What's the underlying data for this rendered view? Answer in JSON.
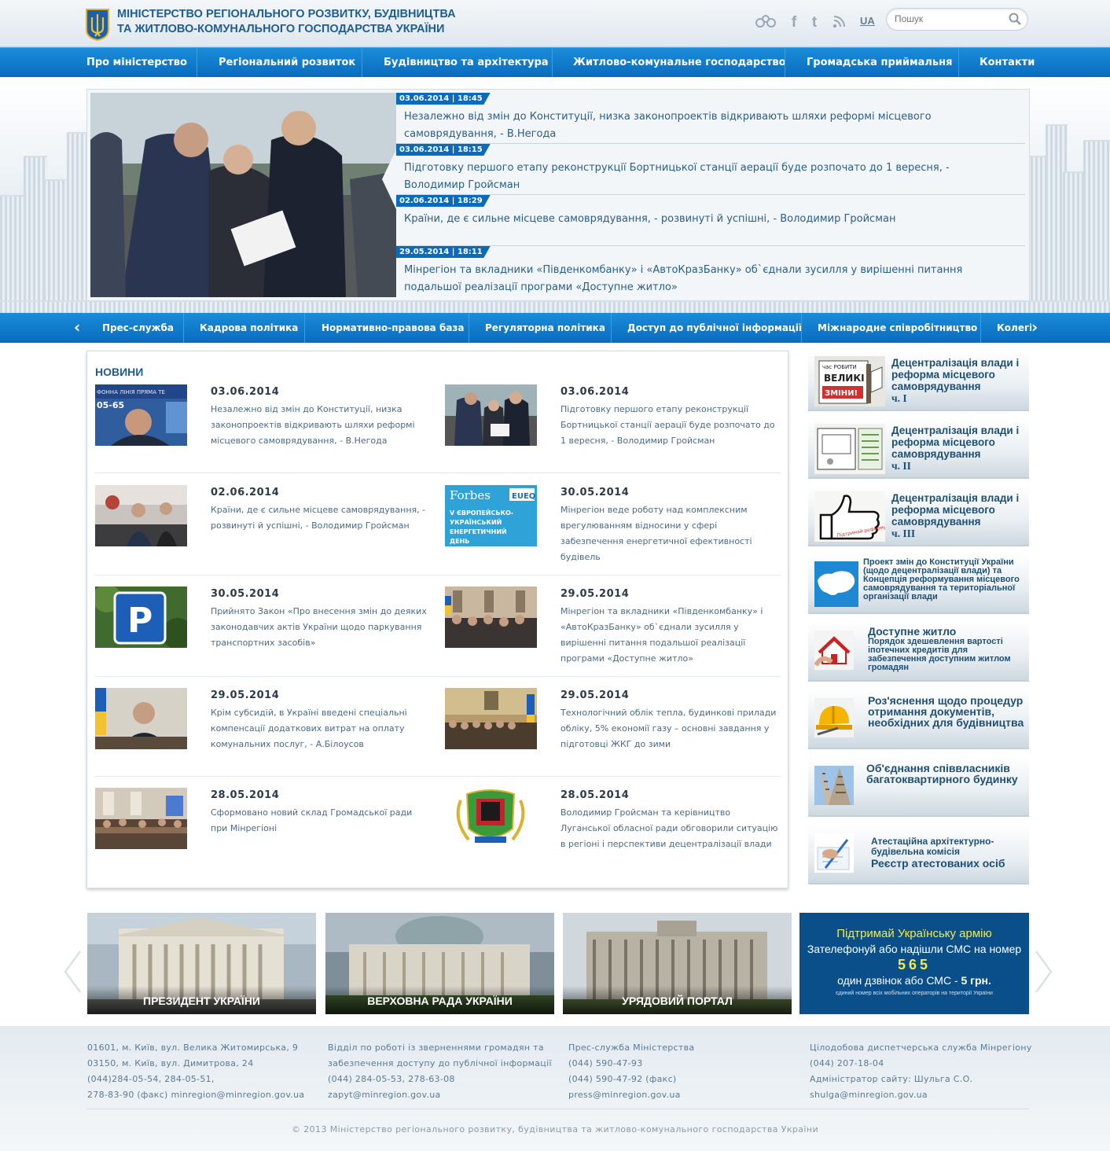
{
  "header": {
    "title_line1": "Міністерство регіонального розвитку, будівництва",
    "title_line2": "та житлово-комунального господарства України",
    "lang": "UA",
    "search_placeholder": "Пошук",
    "icons": [
      "flickr-icon",
      "facebook-icon",
      "twitter-icon",
      "rss-icon"
    ]
  },
  "nav": [
    "Про міністерство",
    "Регіональний розвиток",
    "Будівництво та архітектура",
    "Житлово-комунальне господарство",
    "Громадська приймальня",
    "Контакти"
  ],
  "hero": {
    "items": [
      {
        "date": "03.06.2014 | 18:45",
        "title": "Незалежно від змін до Конституції, низка законопроектів відкривають шляхи реформі місцевого самоврядування, - В.Негода"
      },
      {
        "date": "03.06.2014 | 18:15",
        "title": "Підготовку першого етапу реконструкції Бортницької станції аерації буде розпочато до 1 вересня, - Володимир Гройсман"
      },
      {
        "date": "02.06.2014 | 18:29",
        "title": "Країни, де є сильне місцеве самоврядування, - розвинуті й успішні, - Володимир Гройсман"
      },
      {
        "date": "29.05.2014 | 18:11",
        "title": "Мінрегіон та вкладники «Південкомбанку» і «АвтоКразБанку» об`єднали зусилля у вирішенні питання подальшої реалізації програми «Доступне житло»"
      }
    ]
  },
  "subnav": [
    "Прес-служба",
    "Кадрова політика",
    "Нормативно-правова база",
    "Регуляторна політика",
    "Доступ до публічної інформації",
    "Міжнародне співробітництво",
    "Колегія"
  ],
  "news": {
    "heading": "НОВИНИ",
    "items": [
      {
        "date": "03.06.2014",
        "text": "Незалежно від змін до Конституції, низка законопроектів відкривають шляхи реформі місцевого самоврядування, - В.Негода"
      },
      {
        "date": "03.06.2014",
        "text": "Підготовку першого етапу реконструкції Бортницької станції аерації буде розпочато до 1 вересня, - Володимир Гройсман"
      },
      {
        "date": "02.06.2014",
        "text": "Країни, де є сильне місцеве самоврядування, - розвинуті й успішні, - Володимир Гройсман"
      },
      {
        "date": "30.05.2014",
        "text": "Мінрегіон веде роботу над комплексним врегулюванням відносини у сфері забезпечення енергетичної ефективності будівель"
      },
      {
        "date": "30.05.2014",
        "text": "Прийнято Закон «Про внесення змін до деяких законодавчих актів України щодо паркування транспортних засобів»"
      },
      {
        "date": "29.05.2014",
        "text": "Мінрегіон та вкладники «Південкомбанку» і «АвтоКразБанку» об`єднали зусилля у вирішенні питання подальшої реалізації програми «Доступне житло»"
      },
      {
        "date": "29.05.2014",
        "text": "Крім субсидій, в Україні введені спеціальні компенсації додаткових витрат на оплату комунальних послуг, - А.Білоусов"
      },
      {
        "date": "29.05.2014",
        "text": "Технологічний облік тепла, будинкові прилади обліку, 5% економії газу – основні завдання у підготовці ЖКГ до зими"
      },
      {
        "date": "28.05.2014",
        "text": "Сформовано новий склад Громадської ради при Мінрегіоні"
      },
      {
        "date": "28.05.2014",
        "text": "Володимир Гройсман та керівництво Луганської обласної ради обговорили ситуацію в регіоні і перспективи децентралізації влади"
      }
    ],
    "thumb_texts": {
      "forbes": "Forbes",
      "eueq": "EUEQ",
      "energy_day": "V ЄВРОПЕЙСЬКО-УКРАЇНСЬКИЙ ЕНЕРГЕТИЧНИЙ ДЕНЬ",
      "phone_banner": "ФОННА ЛІНІЯ ПРЯМА ТЕ",
      "phone_number": "05-65",
      "parking": "P"
    }
  },
  "sidebar": [
    {
      "title": "Децентралізація влади і реформа місцевого самоврядування",
      "part": "ч. I",
      "thumb_text": "час РОБИТИ ВЕЛИКІ ЗМІНИ!"
    },
    {
      "title": "Децентралізація влади і реформа місцевого самоврядування",
      "part": "ч. II"
    },
    {
      "title": "Децентралізація влади і реформа місцевого самоврядування",
      "part": "ч. III",
      "thumb_text": "Підтримай реформу!"
    },
    {
      "title": "Проект змін до Конституції України (щодо децентралізації влади) та Концепція реформування місцевого самоврядування та територіальної організації влади"
    },
    {
      "title": "Доступне житло",
      "subtitle": "Порядок здешевлення вартості іпотечних кредитів для забезпечення доступним житлом громадян"
    },
    {
      "title": "Роз'яснення щодо процедур отримання документів, необхідних для будівництва"
    },
    {
      "title": "Об'єднання співвласників багатоквартирного будинку"
    },
    {
      "title": "Атестаційна архітектурно-будівельна комісія",
      "subtitle": "Реєстр атестованих осіб"
    }
  ],
  "banners": [
    {
      "caption": "ПРЕЗИДЕНТ УКРАЇНИ"
    },
    {
      "caption": "ВЕРХОВНА РАДА УКРАЇНИ"
    },
    {
      "caption": "УРЯДОВИЙ ПОРТАЛ"
    },
    {
      "line1": "Підтримай Українську армію",
      "line2": "Зателефонуй або надішли СМС на номер",
      "number": "565",
      "line3": "один дзвінок або СМС - ",
      "price": "5 грн.",
      "line4": "єдиний номер всіх мобільних операторів на території України"
    }
  ],
  "footer": {
    "col1": [
      "01601, м. Київ, вул. Велика Житомирська, 9",
      "03150, м. Київ, вул. Димитрова, 24",
      "(044)284-05-54, 284-05-51,",
      "278-83-90 (факс) minregion@minregion.gov.ua"
    ],
    "col2": [
      "Відділ по роботі із зверненнями громадян та",
      "забезпечення доступу до публічної інформації",
      "(044) 284-05-53, 278-63-08",
      "zapyt@minregion.gov.ua"
    ],
    "col3": [
      "Прес-служба Міністерства",
      "(044) 590-47-93",
      "(044) 590-47-92 (факс)",
      "press@minregion.gov.ua"
    ],
    "col4": [
      "Цілодобова диспетчерська служба Мінрегіону",
      "(044) 207-18-04",
      "Адміністратор сайту: Шульга С.О.",
      "shulga@minregion.gov.ua"
    ],
    "copyright": "© 2013 Міністерство регіонального розвитку, будівництва та житлово-комунального господарства України"
  }
}
